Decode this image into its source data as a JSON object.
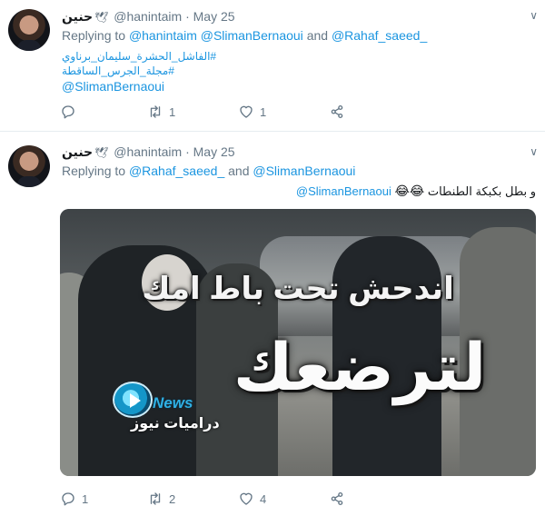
{
  "tweets": [
    {
      "display_name": "حنين",
      "dove": "🕊",
      "handle": "@hanintaim",
      "separator": "·",
      "date": "May 25",
      "replying_prefix": "Replying to",
      "replying_to": [
        "@hanintaim",
        "@SlimanBernaoui",
        "@Rahaf_saeed_"
      ],
      "and_word": "and",
      "hashtags": [
        "#الفاشل_الحشرة_سليمان_برناوي",
        "#مجلة_الجرس_الساقطة"
      ],
      "mention": "@SlimanBernaoui",
      "actions": {
        "replies": "",
        "retweets": "1",
        "likes": "1"
      }
    },
    {
      "display_name": "حنين",
      "dove": "🕊",
      "handle": "@hanintaim",
      "separator": "·",
      "date": "May 25",
      "replying_prefix": "Replying to",
      "replying_to": [
        "@Rahaf_saeed_",
        "@SlimanBernaoui"
      ],
      "and_word": "and",
      "text": "و بطل بكبكة الطنطات",
      "emoji": "😂😂",
      "mention": "@SlimanBernaoui",
      "media": {
        "line1": "اندحش تحت باط امك",
        "line2": "لترضعك",
        "logo_word": "News",
        "brand": "دراميات نيوز"
      },
      "actions": {
        "replies": "1",
        "retweets": "2",
        "likes": "4"
      }
    }
  ],
  "icons": [
    "reply-icon",
    "retweet-icon",
    "like-icon",
    "share-icon",
    "caret-down-icon"
  ]
}
